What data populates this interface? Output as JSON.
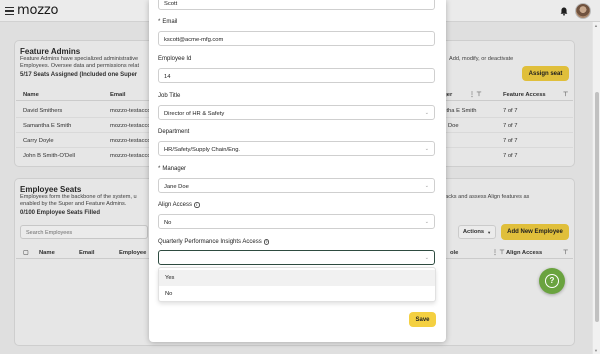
{
  "app": {
    "logo_text": "mozzo"
  },
  "feature_admins": {
    "title": "Feature Admins",
    "desc_line1": "Feature Admins have specialized administrative",
    "desc_line2": "Employees. Oversee data and permissions relat",
    "desc_right": "Add, modify, or deactivate",
    "count": "5/17 Seats Assigned (Included one Super",
    "assign_button": "Assign seat",
    "columns": {
      "name": "Name",
      "email": "Email",
      "manager": "ager",
      "feature_access": "Feature Access"
    },
    "rows": [
      {
        "name": "David Smithers",
        "email": "mozzo-testaccount",
        "manager": "antha E Smith",
        "access": "7 of 7"
      },
      {
        "name": "Samantha E Smith",
        "email": "mozzo-testaccount",
        "manager": "Doe",
        "access": "7 of 7"
      },
      {
        "name": "Carry Doyle",
        "email": "mozzo-testaccount",
        "manager": "",
        "access": "7 of 7"
      },
      {
        "name": "John B Smith-O'Dell",
        "email": "mozzo-testaccount",
        "manager": "",
        "access": "7 of 7"
      }
    ]
  },
  "employee_seats": {
    "title": "Employee Seats",
    "desc_line1": "Employees form the backbone of the system, u",
    "desc_line2": "enabled by the Super and Feature Admins.",
    "desc_right": "d tracks and assess Align features as",
    "count": "0/100 Employee Seats Filled",
    "search_placeholder": "Search Employees",
    "actions_label": "Actions",
    "add_button": "Add New Employee",
    "columns": {
      "name": "Name",
      "email": "Email",
      "employee": "Employee",
      "role": "ole",
      "align_access": "Align Access"
    }
  },
  "modal": {
    "first_name_value": "Scott",
    "email_label": "Email",
    "email_value": "kscott@acme-mfg.com",
    "employee_id_label": "Employee Id",
    "employee_id_value": "14",
    "job_title_label": "Job Title",
    "job_title_value": "Director of HR & Safety",
    "department_label": "Department",
    "department_value": "HR/Safety/Supply Chain/Eng.",
    "manager_label": "Manager",
    "manager_value": "Jane Doe",
    "align_access_label": "Align Access",
    "align_access_value": "No",
    "qpi_label": "Quarterly Performance Insights Access",
    "qpi_value": "",
    "options": [
      "Yes",
      "No"
    ],
    "save_label": "Save",
    "required_mark": "*"
  }
}
